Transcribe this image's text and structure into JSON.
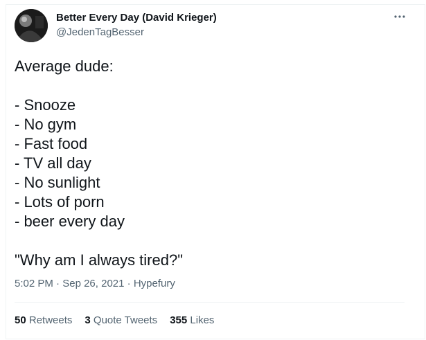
{
  "tweet": {
    "author": {
      "display_name": "Better Every Day (David Krieger)",
      "handle": "@JedenTagBesser"
    },
    "text_lines": [
      "Average dude:",
      "",
      "- Snooze",
      "- No gym",
      "- Fast food",
      "- TV all day",
      "- No sunlight",
      "- Lots of porn",
      "- beer every day",
      "",
      "\"Why am I always tired?\""
    ],
    "time": "5:02 PM",
    "date": "Sep 26, 2021",
    "source": "Hypefury",
    "separator": "·",
    "stats": {
      "retweets_count": "50",
      "retweets_label": "Retweets",
      "quotes_count": "3",
      "quotes_label": "Quote Tweets",
      "likes_count": "355",
      "likes_label": "Likes"
    }
  },
  "icons": {
    "more": "more-horizontal-icon",
    "avatar": "profile-photo"
  },
  "colors": {
    "text_primary": "#0f1419",
    "text_secondary": "#536471",
    "border": "#eff3f4",
    "background": "#ffffff"
  }
}
